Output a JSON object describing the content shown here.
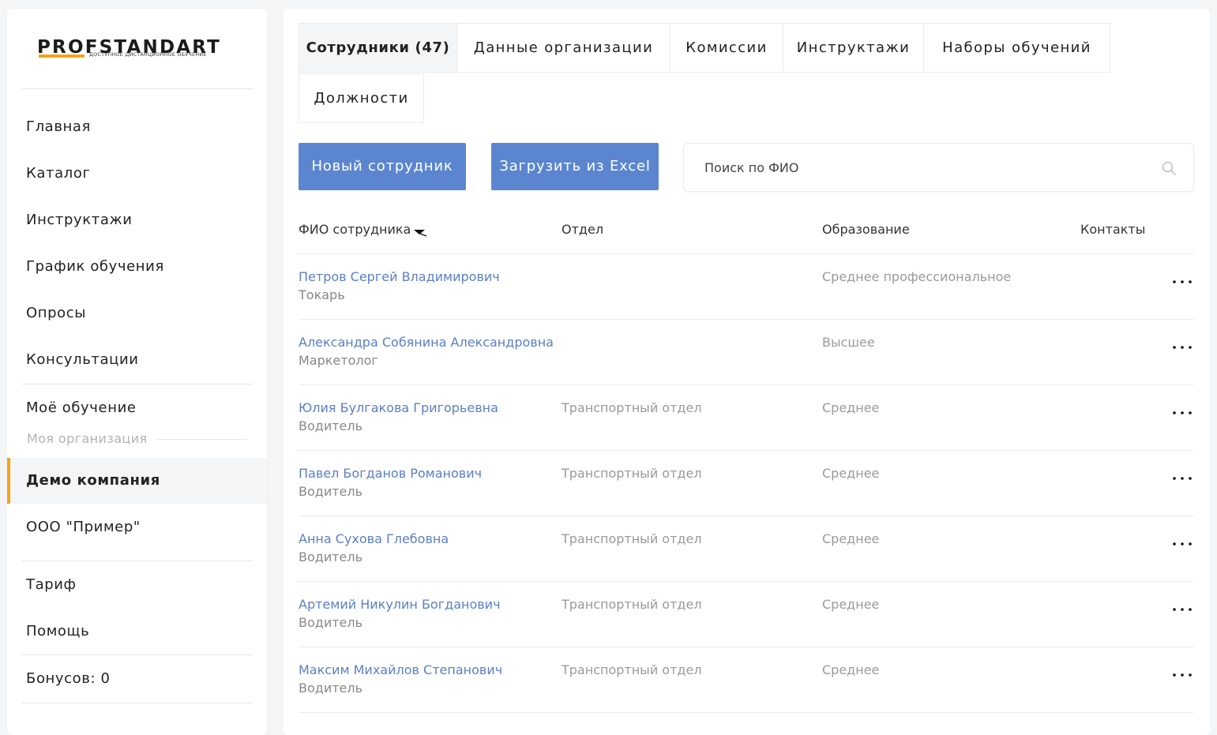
{
  "brand": {
    "name": "PROFSTANDART",
    "tagline": "доступное дистанционное обучение",
    "accent_color": "#f5a31a"
  },
  "sidebar": {
    "nav_top": [
      {
        "label": "Главная"
      },
      {
        "label": "Каталог"
      },
      {
        "label": "Инструктажи"
      },
      {
        "label": "График обучения"
      },
      {
        "label": "Опросы"
      },
      {
        "label": "Консультации"
      }
    ],
    "my_learning": "Моё обучение",
    "section_label": "Моя организация",
    "orgs": [
      {
        "label": "Демо компания",
        "active": true
      },
      {
        "label": "ООО \"Пример\"",
        "active": false
      }
    ],
    "nav_bottom": [
      {
        "label": "Тариф"
      },
      {
        "label": "Помощь"
      }
    ],
    "bonus": "Бонусов: 0"
  },
  "tabs": [
    {
      "label": "Сотрудники (47)",
      "active": true
    },
    {
      "label": "Данные организации",
      "active": false
    },
    {
      "label": "Комиссии",
      "active": false
    },
    {
      "label": "Инструктажи",
      "active": false
    },
    {
      "label": "Наборы обучений",
      "active": false
    },
    {
      "label": "Должности",
      "active": false
    }
  ],
  "toolbar": {
    "new_employee": "Новый сотрудник",
    "import_excel": "Загрузить из Excel",
    "button_color": "#5b86cf"
  },
  "search": {
    "placeholder": "Поиск по ФИО",
    "value": "",
    "icon": "search-icon"
  },
  "table": {
    "columns": [
      "ФИО сотрудника",
      "Отдел",
      "Образование",
      "Контакты"
    ],
    "rows": [
      {
        "name": "Петров Сергей Владимирович",
        "position": "Токарь",
        "department": "",
        "education": "Среднее профессиональное"
      },
      {
        "name": "Александра Собянина Александровна",
        "position": "Маркетолог",
        "department": "",
        "education": "Высшее"
      },
      {
        "name": "Юлия Булгакова Григорьевна",
        "position": "Водитель",
        "department": "Транспортный отдел",
        "education": "Среднее"
      },
      {
        "name": "Павел Богданов Романович",
        "position": "Водитель",
        "department": "Транспортный отдел",
        "education": "Среднее"
      },
      {
        "name": "Анна Сухова Глебовна",
        "position": "Водитель",
        "department": "Транспортный отдел",
        "education": "Среднее"
      },
      {
        "name": "Артемий Никулин Богданович",
        "position": "Водитель",
        "department": "Транспортный отдел",
        "education": "Среднее"
      },
      {
        "name": "Максим Михайлов Степанович",
        "position": "Водитель",
        "department": "Транспортный отдел",
        "education": "Среднее"
      }
    ]
  }
}
